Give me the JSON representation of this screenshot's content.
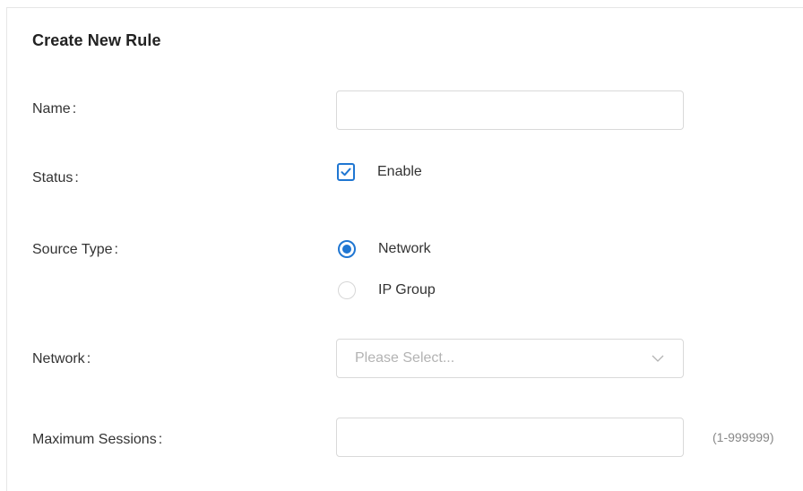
{
  "form": {
    "title": "Create New Rule",
    "name": {
      "label": "Name",
      "colon": ":",
      "value": ""
    },
    "status": {
      "label": "Status",
      "colon": ":",
      "checkbox_label": "Enable",
      "checked": true
    },
    "source_type": {
      "label": "Source Type",
      "colon": ":",
      "options": [
        {
          "label": "Network",
          "selected": true
        },
        {
          "label": "IP Group",
          "selected": false
        }
      ]
    },
    "network": {
      "label": "Network",
      "colon": ":",
      "placeholder": "Please Select..."
    },
    "max_sessions": {
      "label": "Maximum Sessions",
      "colon": ":",
      "value": "",
      "hint": "(1-999999)"
    }
  },
  "colors": {
    "accent": "#1f76d2",
    "border": "#d9d9d9",
    "placeholder": "#b3b3b3",
    "hint": "#888888"
  },
  "icons": {
    "checkbox_mark": "checkmark-icon",
    "select_arrow": "chevron-down-icon"
  }
}
